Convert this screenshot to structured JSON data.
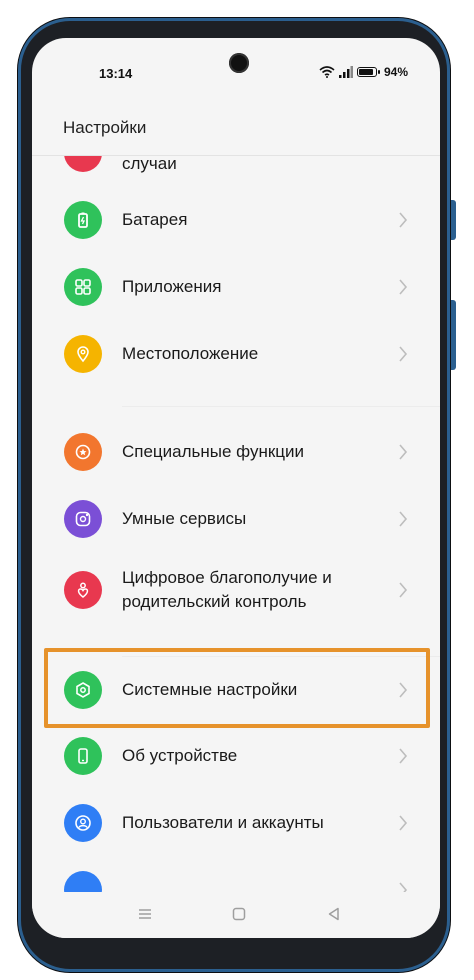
{
  "status_bar": {
    "time": "13:14",
    "battery_text": "94%",
    "icons": [
      "wifi-icon",
      "signal-icon",
      "battery-icon"
    ]
  },
  "header": {
    "title": "Настройки"
  },
  "items": [
    {
      "label": "случаи",
      "icon": "emergency-icon",
      "color": "#e8384f"
    },
    {
      "label": "Батарея",
      "icon": "battery-icon",
      "color": "#2fc25b"
    },
    {
      "label": "Приложения",
      "icon": "apps-grid-icon",
      "color": "#2fc25b"
    },
    {
      "label": "Местоположение",
      "icon": "location-pin-icon",
      "color": "#f5b400"
    },
    {
      "label": "Специальные функции",
      "icon": "accessibility-star-icon",
      "color": "#f2762e"
    },
    {
      "label": "Умные сервисы",
      "icon": "smart-services-icon",
      "color": "#7b4fd6"
    },
    {
      "label_line1": "Цифровое благополучие и",
      "label_line2": "родительский контроль",
      "icon": "wellbeing-heart-icon",
      "color": "#e8384f"
    },
    {
      "label": "Системные настройки",
      "icon": "system-settings-icon",
      "color": "#2fc25b"
    },
    {
      "label": "Об устройстве",
      "icon": "phone-device-icon",
      "color": "#2fc25b"
    },
    {
      "label": "Пользователи и аккаунты",
      "icon": "user-account-icon",
      "color": "#2f7ef5"
    },
    {
      "label": "",
      "icon": "next-item-icon",
      "color": "#2f7ef5"
    }
  ],
  "highlight_color": "#e6922b",
  "nav": {
    "icons": [
      "menu-icon",
      "home-icon",
      "back-icon"
    ]
  }
}
